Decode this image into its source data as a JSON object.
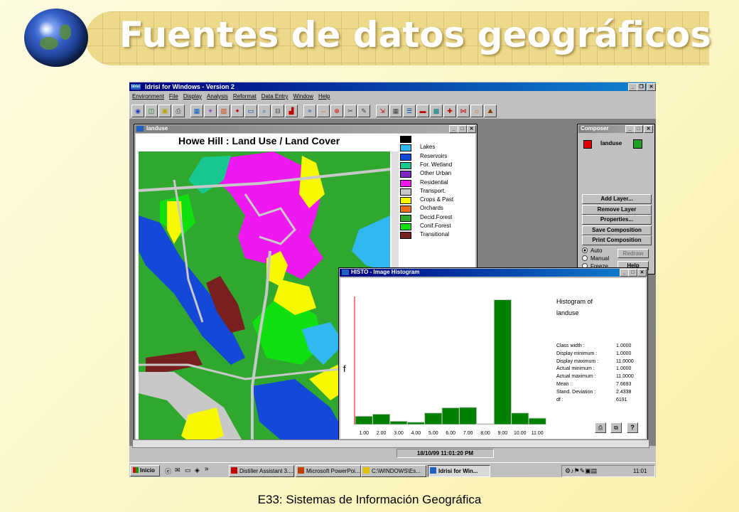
{
  "slide": {
    "title": "Fuentes de datos geográficos",
    "footer": "E33: Sistemas de Información Geográfica"
  },
  "app": {
    "title": "Idrisi for Windows  - Version 2",
    "logo_text": "Idrisi",
    "menu": [
      "Environment",
      "File",
      "Display",
      "Analysis",
      "Reformat",
      "Data Entry",
      "Window",
      "Help"
    ],
    "toolbar_icons": [
      "globe-icon",
      "layers-icon",
      "image-icon",
      "print-icon",
      "display-icon",
      "query-icon",
      "palette-icon",
      "symbol-icon",
      "composer-icon",
      "zoom-icon",
      "measure-icon",
      "chart-icon",
      "waves-icon",
      "arrows-icon",
      "target-icon",
      "scissors-icon",
      "edit-icon",
      "import-icon",
      "table-icon",
      "list-icon",
      "color-icon",
      "grid-icon",
      "digitize-icon",
      "network-icon",
      "sun-icon",
      "mountain-icon"
    ]
  },
  "map_window": {
    "title": "landuse",
    "map_title": "Howe Hill : Land Use / Land Cover",
    "legend": [
      {
        "label": "",
        "color": "#000000"
      },
      {
        "label": "Lakes",
        "color": "#30b8f0"
      },
      {
        "label": "Reservoirs",
        "color": "#1448d8"
      },
      {
        "label": "For. Wetland",
        "color": "#18c890"
      },
      {
        "label": "Other Urban",
        "color": "#7828c0"
      },
      {
        "label": "Residential",
        "color": "#f018f0"
      },
      {
        "label": "Transport.",
        "color": "#c8c8c8"
      },
      {
        "label": "Crops & Past",
        "color": "#f8f800"
      },
      {
        "label": "Orchards",
        "color": "#f07018"
      },
      {
        "label": "Decid.Forest",
        "color": "#30a830"
      },
      {
        "label": "Conif.Forest",
        "color": "#10e010"
      },
      {
        "label": "Transitional",
        "color": "#782020"
      }
    ]
  },
  "composer": {
    "title": "Composer",
    "layer_name": "landuse",
    "buttons": [
      "Add Layer...",
      "Remove Layer",
      "Properties...",
      "Save Composition",
      "Print Composition"
    ],
    "radios": [
      {
        "label": "Auto",
        "checked": true
      },
      {
        "label": "Manual",
        "checked": false
      },
      {
        "label": "Freeze",
        "checked": false
      }
    ],
    "redraw_label": "Redraw",
    "help_label": "Help"
  },
  "histo_window": {
    "title": "HISTO - Image Histogram",
    "heading_line1": "Histogram of",
    "heading_line2": "landuse",
    "stats": [
      {
        "label": "Class width :",
        "value": "1.0000"
      },
      {
        "label": "Display minimum :",
        "value": "1.0000"
      },
      {
        "label": "Display maximum :",
        "value": "11.0000"
      },
      {
        "label": "Actual minimum :",
        "value": "1.0000"
      },
      {
        "label": "Actual maximum :",
        "value": "11.0000"
      },
      {
        "label": "Mean :",
        "value": "7.6693"
      },
      {
        "label": "Stand. Deviation :",
        "value": "2.4338"
      },
      {
        "label": "df :",
        "value": "6191"
      }
    ],
    "y_axis_label": "f",
    "footer_icons": [
      "print-icon",
      "copy-icon",
      "help-icon"
    ]
  },
  "chart_data": {
    "type": "bar",
    "title": "Histogram of landuse",
    "ylabel": "f",
    "categories": [
      "1.00",
      "2.00",
      "3.00",
      "4.00",
      "5.00",
      "6.00",
      "7.00",
      "8.00",
      "9.00",
      "10.00",
      "11.00"
    ],
    "values": [
      105,
      130,
      42,
      30,
      145,
      210,
      215,
      10,
      1560,
      145,
      80
    ],
    "ylim": [
      0,
      1600
    ],
    "color": "#008000"
  },
  "status": {
    "datetime": "18/10/99 11:01:20 PM"
  },
  "taskbar": {
    "start_label": "Inicio",
    "items": [
      "Distiller Assistant 3....",
      "Microsoft PowerPoi...",
      "C:\\WINDOWS\\Es...",
      "Idrisi for Win..."
    ],
    "clock": "11:01",
    "chevron": "»"
  }
}
